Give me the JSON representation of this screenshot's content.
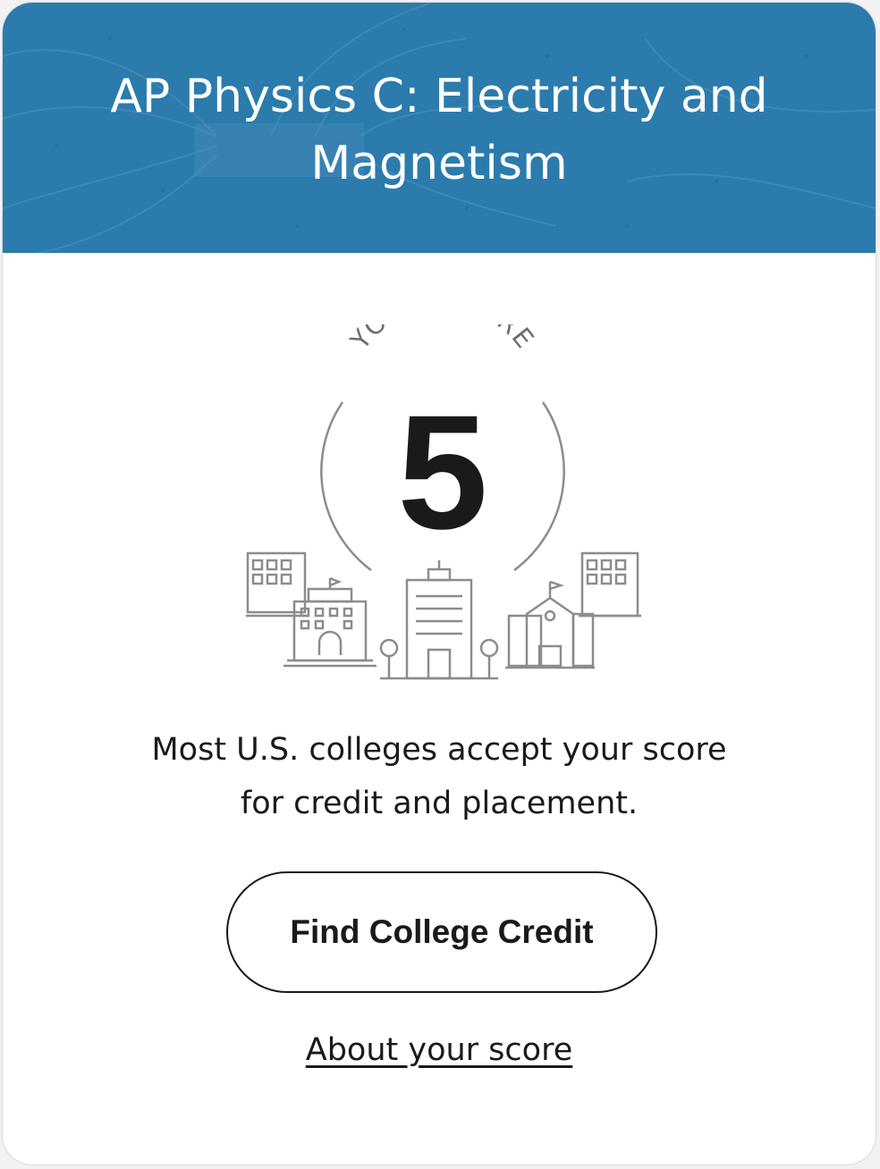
{
  "header": {
    "title": "AP Physics C: Electricity and Magnetism",
    "background_color": "#2b7bad"
  },
  "score": {
    "label": "YOUR SCORE",
    "value": "5",
    "illustration": "college-buildings-illustration"
  },
  "message": "Most U.S. colleges accept your score for credit and placement.",
  "actions": {
    "primary_label": "Find College Credit",
    "link_label": "About your score"
  },
  "colors": {
    "text": "#1a1a1a",
    "illustration": "#8c8c8c"
  }
}
